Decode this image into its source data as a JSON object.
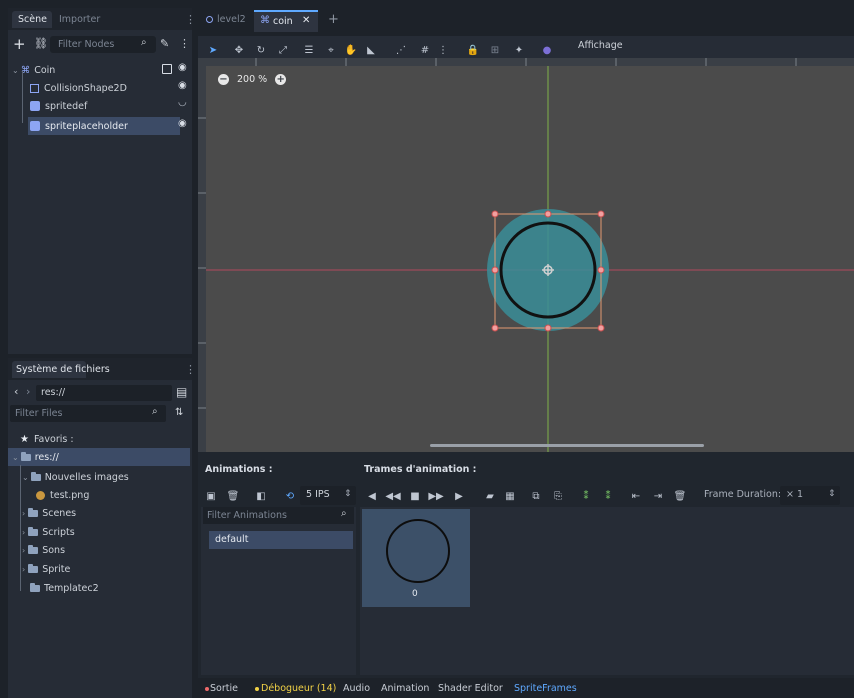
{
  "scene_dock": {
    "tabs": [
      "Scène",
      "Importer"
    ],
    "filter_placeholder": "Filter Nodes",
    "tree": [
      {
        "label": "Coin"
      },
      {
        "label": "CollisionShape2D"
      },
      {
        "label": "spritedef"
      },
      {
        "label": "spriteplaceholder"
      }
    ]
  },
  "filesystem": {
    "tab": "Système de fichiers",
    "path": "res://",
    "filter_placeholder": "Filter Files",
    "items": [
      {
        "label": "Favoris :"
      },
      {
        "label": "res://"
      },
      {
        "label": "Nouvelles images"
      },
      {
        "label": "test.png"
      },
      {
        "label": "Scenes"
      },
      {
        "label": "Scripts"
      },
      {
        "label": "Sons"
      },
      {
        "label": "Sprite"
      },
      {
        "label": "Templatec2"
      }
    ]
  },
  "editor_tabs": [
    {
      "label": "level2"
    },
    {
      "label": "coin",
      "close": "✕"
    }
  ],
  "add_tab": "+",
  "toolbar": {
    "view_menu": "Affichage"
  },
  "zoom": {
    "minus": "−",
    "value": "200 %",
    "plus": "+"
  },
  "colors": {
    "accent": "#5fa9ff",
    "debug_yellow": "#f2d246",
    "error_red": "#ef6a6a",
    "viewport": "#4b4b4b",
    "shape_teal": "#3a8d98"
  },
  "animations": {
    "title": "Animations :",
    "fps": "5 IPS",
    "filter_placeholder": "Filter Animations",
    "list": [
      "default"
    ]
  },
  "frames": {
    "title": "Trames d'animation :",
    "duration_label": "Frame Duration:",
    "duration_value": "× 1",
    "items": [
      {
        "index": "0"
      }
    ]
  },
  "bottom_tabs": [
    "Sortie",
    "Débogueur (14)",
    "Audio",
    "Animation",
    "Shader Editor",
    "SpriteFrames"
  ]
}
